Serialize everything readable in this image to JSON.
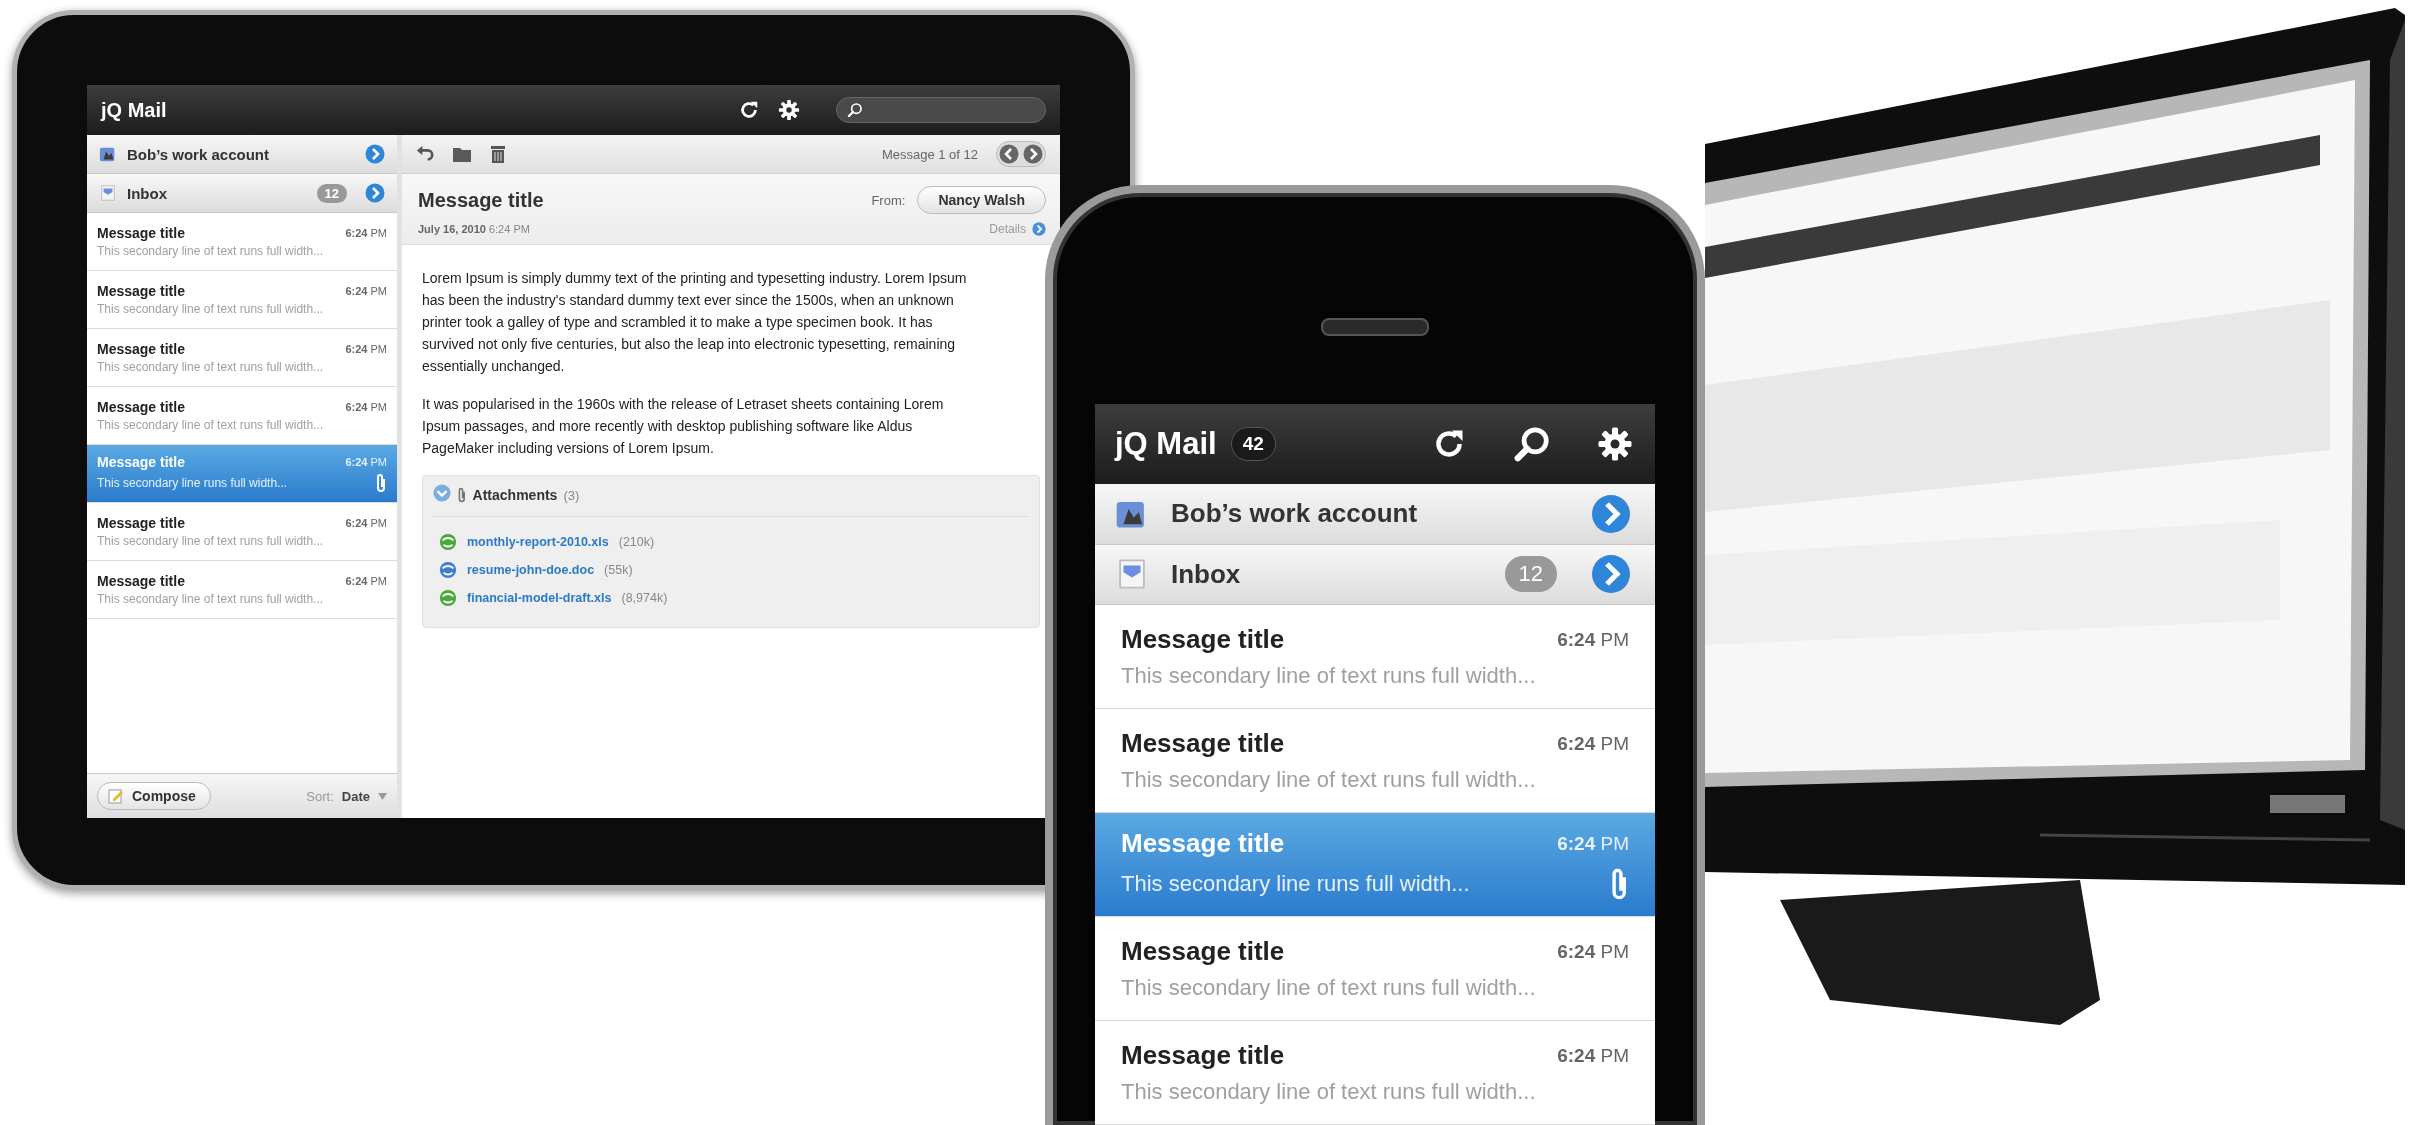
{
  "tablet": {
    "app_title": "jQ Mail",
    "account": "Bob’s work account",
    "folder": {
      "name": "Inbox",
      "count": "12"
    },
    "messages": [
      {
        "title": "Message title",
        "time": "**6:24** PM",
        "preview": "This secondary line of text runs full width...",
        "selected": false,
        "attachment": false
      },
      {
        "title": "Message title",
        "time": "**6:24** PM",
        "preview": "This secondary line of text runs full width...",
        "selected": false,
        "attachment": false
      },
      {
        "title": "Message title",
        "time": "**6:24** PM",
        "preview": "This secondary line of text runs full width...",
        "selected": false,
        "attachment": false
      },
      {
        "title": "Message title",
        "time": "**6:24** PM",
        "preview": "This secondary line of text runs full width...",
        "selected": false,
        "attachment": false
      },
      {
        "title": "Message title",
        "time": "**6:24** PM",
        "preview": "This secondary line runs full width...",
        "selected": true,
        "attachment": true
      },
      {
        "title": "Message title",
        "time": "**6:24** PM",
        "preview": "This secondary line of text runs full width...",
        "selected": false,
        "attachment": false
      },
      {
        "title": "Message title",
        "time": "**6:24** PM",
        "preview": "This secondary line of text runs full width...",
        "selected": false,
        "attachment": false
      }
    ],
    "compose": "Compose",
    "sort": "Sort: **Date**",
    "position": "Message 1 of 12",
    "message": {
      "title": "Message title",
      "from_label": "From:",
      "from": "Nancy Walsh",
      "date": "**July 16, 2010** 6:24 PM",
      "details": "Details",
      "paragraphs": [
        "Lorem Ipsum is simply dummy text of the printing and typesetting industry. Lorem Ipsum has been the industry's standard dummy text ever since the 1500s, when an unknown printer took a galley of type and scrambled it to make a type specimen book. It has survived not only five centuries, but also the leap into electronic typesetting, remaining essentially unchanged.",
        "It was popularised in the 1960s with the release of Letraset sheets containing Lorem Ipsum passages, and more recently with desktop publishing software like Aldus PageMaker including versions of Lorem Ipsum."
      ],
      "attachments": {
        "heading": "Attachments",
        "count": "(3)",
        "expanded": true,
        "files": [
          {
            "name": "monthly-report-2010.xls",
            "size": "(210k)",
            "kind": "xls"
          },
          {
            "name": "resume-john-doe.doc",
            "size": "(55k)",
            "kind": "doc"
          },
          {
            "name": "financial-model-draft.xls",
            "size": "(8,974k)",
            "kind": "xls"
          }
        ]
      }
    }
  },
  "phone": {
    "app_title": "jQ Mail",
    "unread": "42",
    "account": "Bob’s work account",
    "folder": {
      "name": "Inbox",
      "count": "12"
    },
    "messages": [
      {
        "title": "Message title",
        "time": "**6:24** PM",
        "preview": "This secondary line of text runs full width...",
        "selected": false,
        "attachment": false
      },
      {
        "title": "Message title",
        "time": "**6:24** PM",
        "preview": "This secondary line of text runs full width...",
        "selected": false,
        "attachment": false
      },
      {
        "title": "Message title",
        "time": "**6:24** PM",
        "preview": "This secondary line runs full width...",
        "selected": true,
        "attachment": true
      },
      {
        "title": "Message title",
        "time": "**6:24** PM",
        "preview": "This secondary line of text runs full width...",
        "selected": false,
        "attachment": false
      },
      {
        "title": "Message title",
        "time": "**6:24** PM",
        "preview": "This secondary line of text runs full width...",
        "selected": false,
        "attachment": false
      }
    ]
  }
}
